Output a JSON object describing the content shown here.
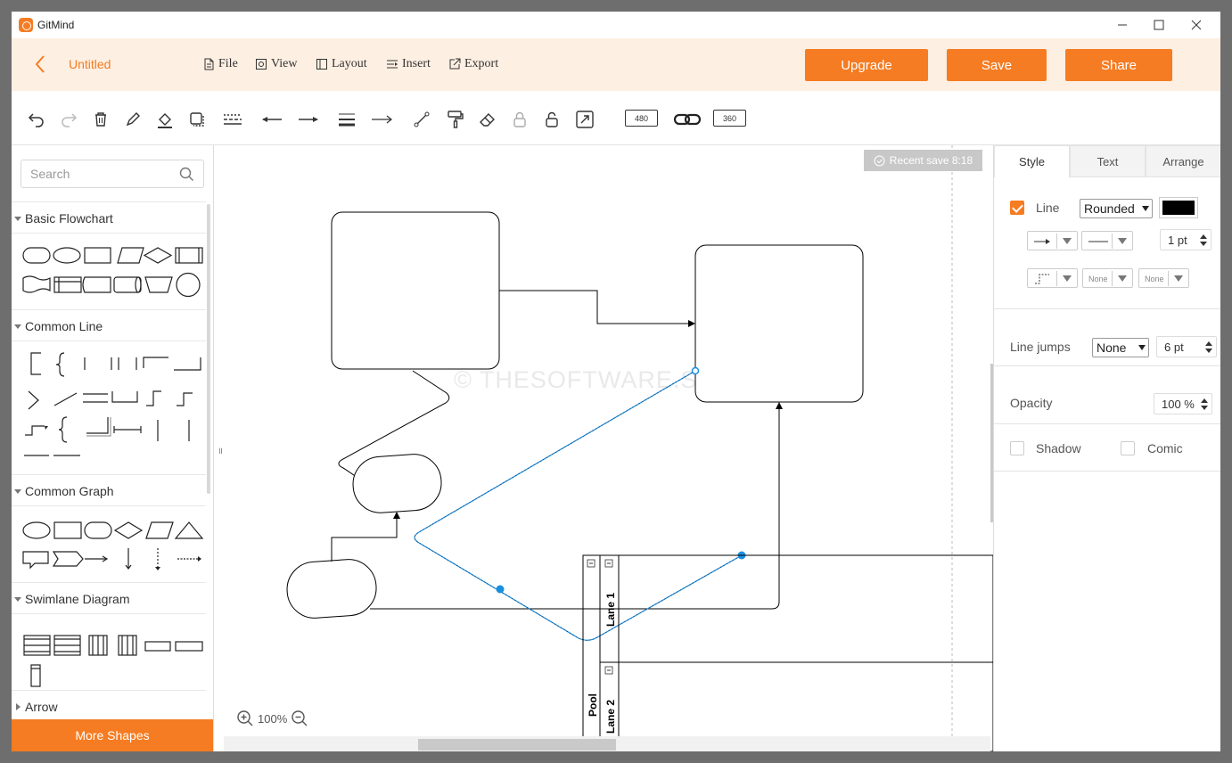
{
  "window": {
    "app_name": "GitMind"
  },
  "header": {
    "doc_title": "Untitled",
    "menus": [
      "File",
      "View",
      "Layout",
      "Insert",
      "Export"
    ],
    "buttons": {
      "upgrade": "Upgrade",
      "save": "Save",
      "share": "Share"
    },
    "accent": "#f57c22"
  },
  "toolbar": {
    "icons": [
      "undo-icon",
      "redo-icon",
      "delete-icon",
      "pen-icon",
      "fill-icon",
      "copy-style-icon",
      "dashed-line-icon",
      "arrow-left-icon",
      "arrow-right-icon",
      "line-weight-icon",
      "connector-arrow-icon",
      "waypoint-icon",
      "paint-roller-icon",
      "eraser-icon",
      "lock-icon",
      "unlock-icon",
      "fit-icon"
    ],
    "width_value": "480",
    "height_value": "360",
    "link_icon": "link-icon"
  },
  "left_panel": {
    "search_placeholder": "Search",
    "sections": [
      "Basic Flowchart",
      "Common Line",
      "Common Graph",
      "Swimlane Diagram",
      "Arrow"
    ],
    "more_shapes": "More Shapes"
  },
  "canvas": {
    "recent_save": "Recent save 8:18",
    "watermark": "© THESOFTWARE.SHOP",
    "zoom": "100%",
    "swimlane": {
      "pool": "Pool",
      "lanes": [
        "Lane 1",
        "Lane 2"
      ]
    }
  },
  "right_panel": {
    "tabs": [
      "Style",
      "Text",
      "Arrange"
    ],
    "line_label": "Line",
    "line_checked": true,
    "line_style": "Rounded",
    "line_color": "#000000",
    "line_width": "1 pt",
    "start_marker": "None",
    "end_marker": "None",
    "line_jumps_label": "Line jumps",
    "line_jumps_value": "None",
    "line_jumps_size": "6 pt",
    "opacity_label": "Opacity",
    "opacity_value": "100 %",
    "shadow_label": "Shadow",
    "comic_label": "Comic"
  }
}
